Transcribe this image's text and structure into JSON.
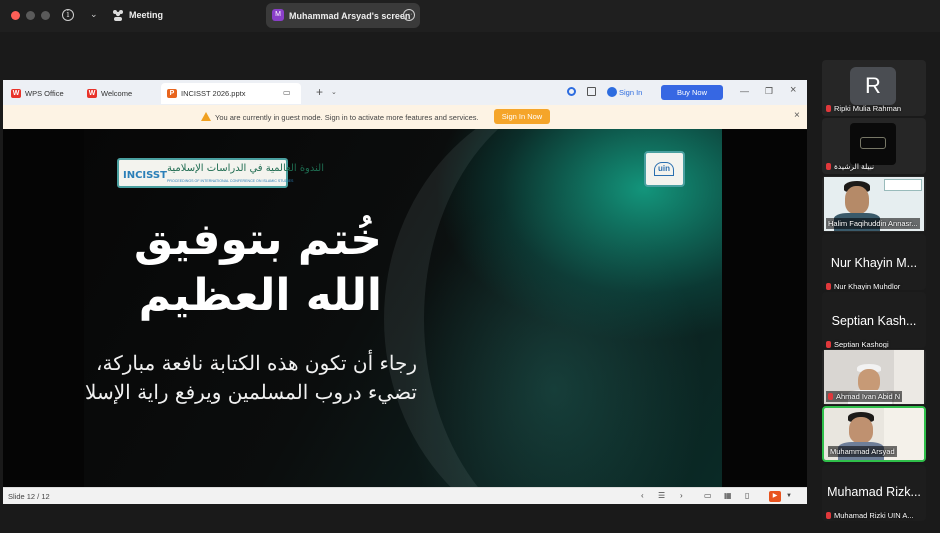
{
  "zoom": {
    "meeting_label": "Meeting",
    "share_avatar_letter": "M",
    "share_label": "Muhammad Arsyad's screen",
    "info_glyph": "i",
    "chevron_glyph": "⌄",
    "more_glyph": "···"
  },
  "wps": {
    "tabs": [
      {
        "label": "WPS Office",
        "icon": "wps-logo"
      },
      {
        "label": "Welcome",
        "icon": "wps-logo"
      },
      {
        "label": "INCISST 2026.pptx",
        "icon": "presentation-logo"
      }
    ],
    "tab_logo_letter_w": "W",
    "tab_logo_letter_p": "P",
    "new_tab_glyph": "+",
    "sign_in_label": "Sign In",
    "buy_now_label": "Buy Now",
    "guest_message": "You are currently in guest mode. Sign in to activate more features and services.",
    "sign_in_now_label": "Sign In Now",
    "slide_counter": "Slide 12 / 12",
    "close_glyph": "×",
    "minimize_glyph": "—",
    "restore_glyph": "❐"
  },
  "slide": {
    "logo_short": "INCISST",
    "logo_arabic": "الندوة العالمية في الدراسات الإسلامية",
    "logo_english": "PROCEEDINGS OF INTERNATIONAL CONFERENCE ON ISLAMIC STUDIES",
    "badge_text": "uin",
    "title_line1": "خُتم بتوفيق",
    "title_line2": "الله العظيم",
    "body_line1": "رجاء أن تكون هذه الكتابة نافعة مباركة،",
    "body_line2": "تضيء دروب المسلمين ويرفع راية الإسلام عاليا"
  },
  "participants": [
    {
      "type": "avatar",
      "avatar_letter": "R",
      "name": "Ripki Mulia Rahman",
      "muted": true
    },
    {
      "type": "image",
      "name": "نبيلة الرشيدة",
      "muted": true
    },
    {
      "type": "video",
      "name": "Halim Faqihuddin Annasr...",
      "muted": false
    },
    {
      "type": "name",
      "display_name": "Nur Khayin M...",
      "name": "Nur Khayin Muhdlor",
      "muted": true
    },
    {
      "type": "name",
      "display_name": "Septian Kash...",
      "name": "Septian Kashogi",
      "muted": true
    },
    {
      "type": "video",
      "name": "Ahmad Ivan Abid N",
      "muted": true
    },
    {
      "type": "video",
      "name": "Muhammad Arsyad",
      "muted": false,
      "active_speaker": true
    },
    {
      "type": "name",
      "display_name": "Muhamad Rizk...",
      "name": "Muhamad Rizki UIN A...",
      "muted": true
    }
  ],
  "participants_more_glyph": "...",
  "colors": {
    "accent_blue": "#3667e3",
    "sign_in_now_orange": "#f5a52a",
    "active_speaker_border": "#2fbf4a",
    "mic_muted": "#e0383b"
  }
}
